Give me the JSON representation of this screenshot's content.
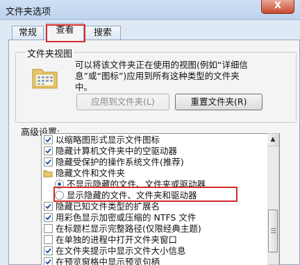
{
  "window": {
    "title": "文件夹选项",
    "close_label": "X"
  },
  "tabs": [
    {
      "label": "常规"
    },
    {
      "label": "查看"
    },
    {
      "label": "搜索"
    }
  ],
  "folder_views": {
    "group_label": "文件夹视图",
    "description_lines": [
      "可以将该文件夹正在使用的视图(例如“详细信",
      "息”或“图标”)应用到所有这种类型的文件夹",
      "中。"
    ],
    "apply_button": "应用到文件夹(L)",
    "reset_button": "重置文件夹(R)"
  },
  "advanced": {
    "label": "高级设置:",
    "items": [
      {
        "type": "checkbox",
        "checked": true,
        "label": "以缩略图形式显示文件图标"
      },
      {
        "type": "checkbox",
        "checked": true,
        "label": "隐藏计算机文件夹中的空驱动器"
      },
      {
        "type": "checkbox",
        "checked": true,
        "label": "隐藏受保护的操作系统文件(推荐)"
      },
      {
        "type": "folder",
        "label": "隐藏文件和文件夹"
      },
      {
        "type": "radio",
        "checked": true,
        "label": "不显示隐藏的文件、文件夹或驱动器"
      },
      {
        "type": "radio",
        "checked": false,
        "label": "显示隐藏的文件、文件夹和驱动器"
      },
      {
        "type": "checkbox",
        "checked": true,
        "label": "隐藏已知文件类型的扩展名"
      },
      {
        "type": "checkbox",
        "checked": true,
        "label": "用彩色显示加密或压缩的 NTFS 文件"
      },
      {
        "type": "checkbox",
        "checked": false,
        "label": "在标题栏显示完整路径(仅限经典主题)"
      },
      {
        "type": "checkbox",
        "checked": false,
        "label": "在单独的进程中打开文件夹窗口"
      },
      {
        "type": "checkbox",
        "checked": true,
        "label": "在文件夹提示中显示文件大小信息"
      },
      {
        "type": "checkbox",
        "checked": true,
        "label": "在预览窗格中显示预览句柄"
      }
    ]
  },
  "colors": {
    "highlight_box": "#d32a2a",
    "check_mark": "#1d4f94"
  }
}
